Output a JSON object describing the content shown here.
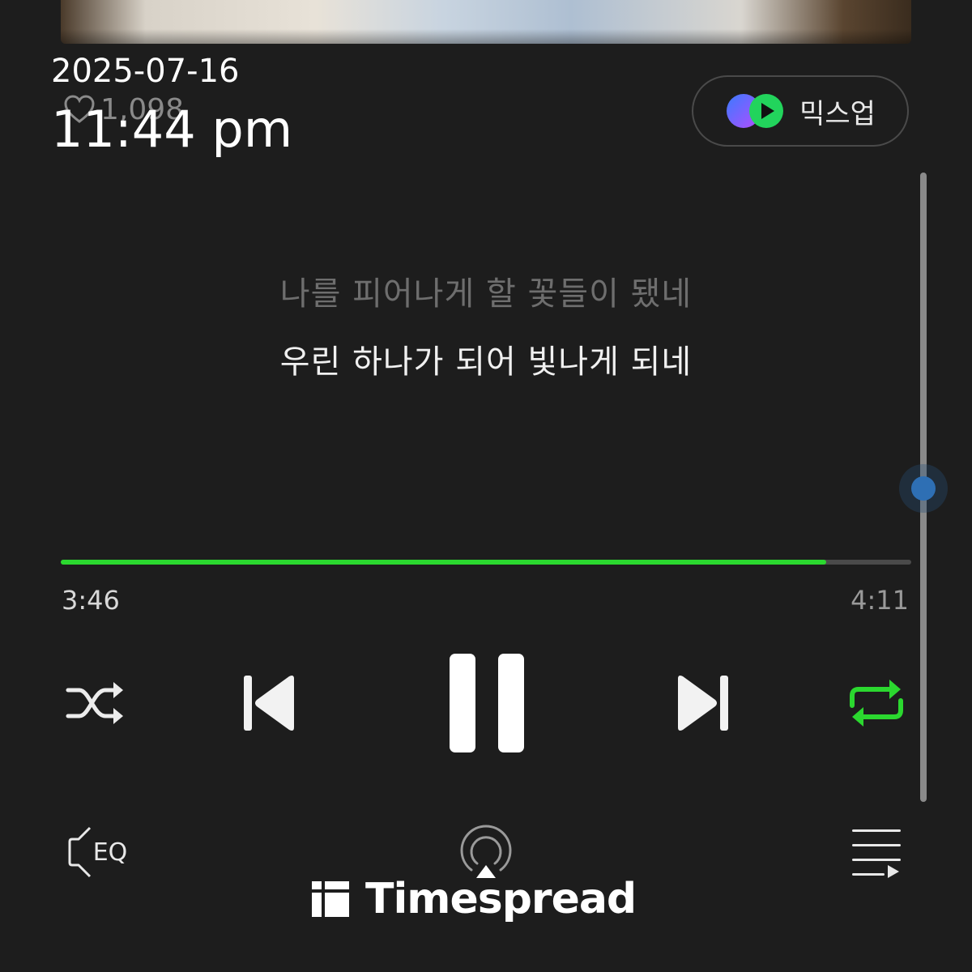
{
  "overlay": {
    "date": "2025-07-16",
    "time": "11:44 pm"
  },
  "song": {
    "likes": "1,098"
  },
  "mixup": {
    "label": "믹스업"
  },
  "lyrics": {
    "previous": "나를 피어나게 할 꽃들이 됐네",
    "current": "우린 하나가 되어 빛나게 되네"
  },
  "playback": {
    "elapsed": "3:46",
    "total": "4:11",
    "progress_fraction": 0.9,
    "state": "playing",
    "repeat_active": true,
    "accent_color": "#2bd82f"
  },
  "controls": {
    "shuffle_icon": "shuffle-icon",
    "previous_icon": "skip-previous-icon",
    "pause_icon": "pause-icon",
    "next_icon": "skip-next-icon",
    "repeat_icon": "repeat-icon"
  },
  "bottom_bar": {
    "eq_label": "EQ",
    "airplay_icon": "airplay-icon",
    "playlist_icon": "playlist-icon"
  },
  "watermark": {
    "text": "Timespread"
  }
}
